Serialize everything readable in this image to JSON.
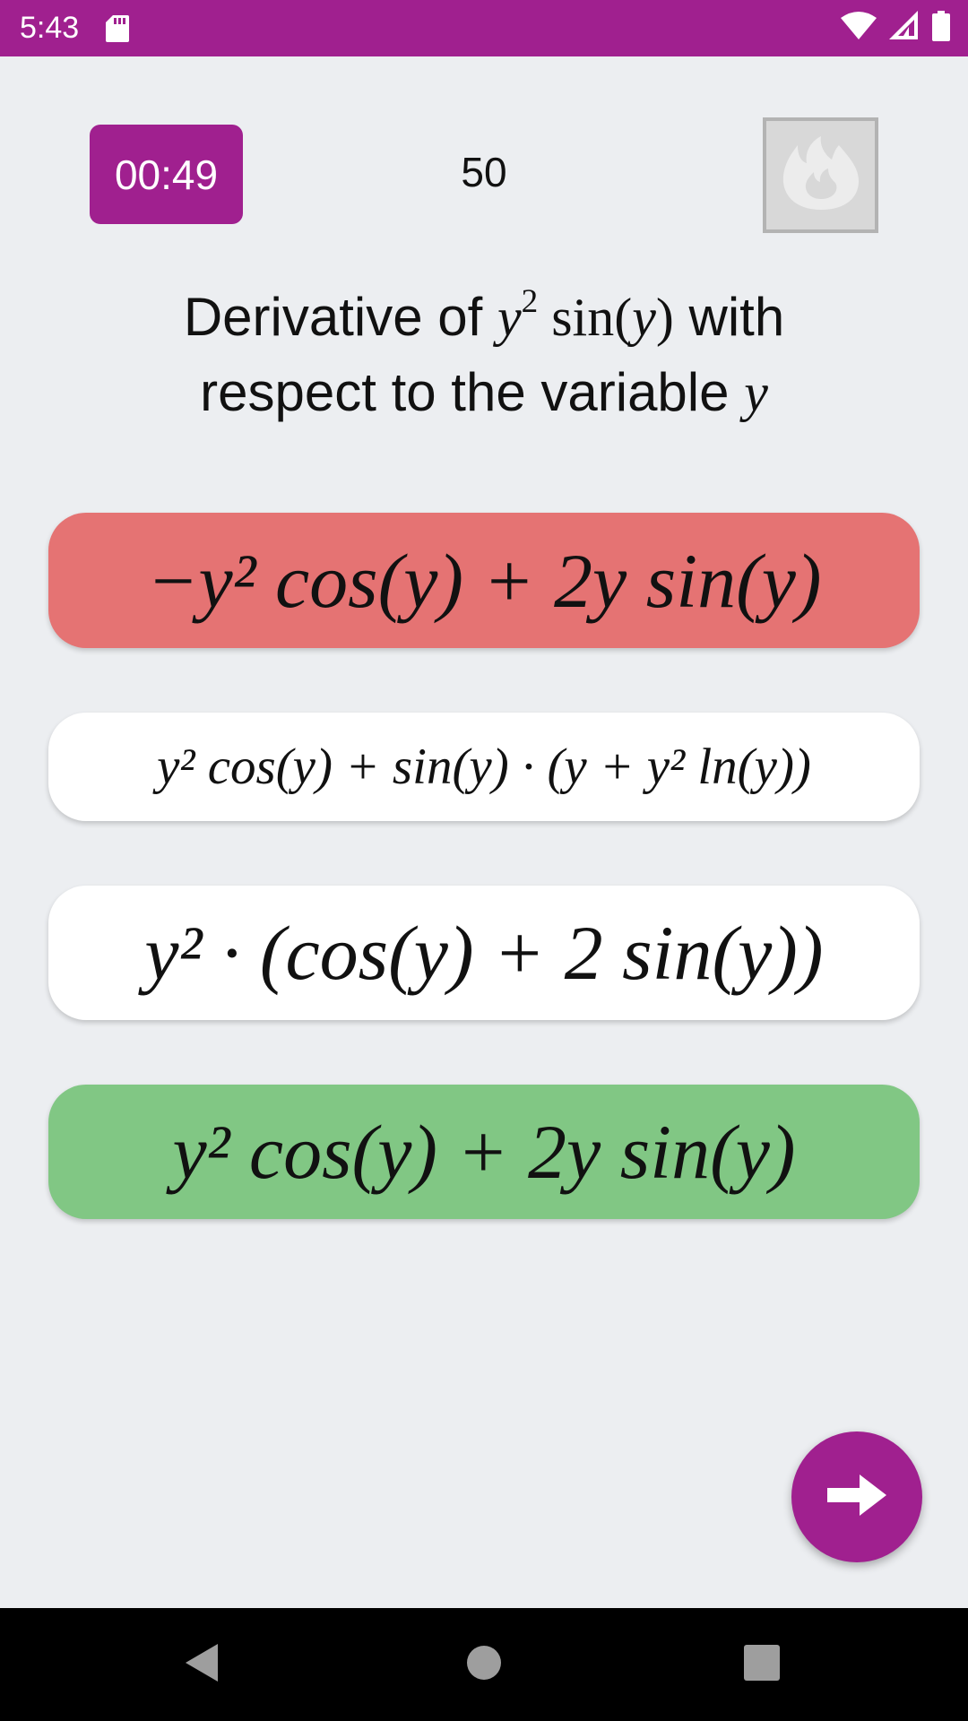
{
  "status_bar": {
    "time": "5:43",
    "color": "#a0208f",
    "icons": [
      "sd-card-icon",
      "wifi-icon",
      "signal-icon",
      "battery-icon"
    ]
  },
  "quiz": {
    "timer": "00:49",
    "score": "50",
    "streak_icon": "flame-icon"
  },
  "question": {
    "prefix": "Derivative of",
    "suffix": "with",
    "line2": "respect to the variable"
  },
  "answers": [
    {
      "state": "wrong",
      "color": "#e57373",
      "expression": "−y² cos(y) + 2y sin(y)"
    },
    {
      "state": "neutral",
      "color": "#ffffff",
      "expression": "y² cos(y) + sin(y) · (y + y² ln(y))"
    },
    {
      "state": "neutral",
      "color": "#ffffff",
      "expression": "y² · (cos(y) + 2 sin(y))"
    },
    {
      "state": "correct",
      "color": "#81c784",
      "expression": "y² cos(y) + 2y sin(y)"
    }
  ],
  "next_button": {
    "icon": "arrow-right-icon"
  },
  "nav_bar": {
    "icons": [
      "back-icon",
      "home-icon",
      "recents-icon"
    ]
  }
}
